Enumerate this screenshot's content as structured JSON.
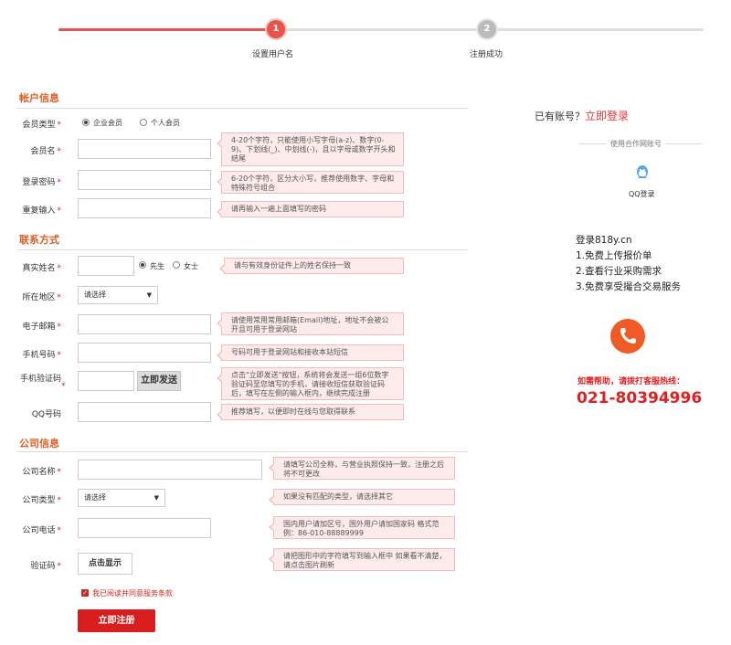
{
  "progress": {
    "fraction": 0.34,
    "steps": [
      {
        "num": "1",
        "label": "设置用户名",
        "state": "active"
      },
      {
        "num": "2",
        "label": "注册成功",
        "state": "inactive"
      }
    ]
  },
  "account": {
    "title": "帐户信息",
    "member_type_label": "会员类型",
    "member_type_options": [
      "企业会员",
      "个人会员"
    ],
    "member_type_selected": "企业会员",
    "username_label": "会员名",
    "username_tip": "4-20个字符，只能使用小写字母(a-z)、数字(0-9)、下划线(_)、中划线(-)，且以字母或数字开头和结尾",
    "password_label": "登录密码",
    "password_tip": "6-20个字符，区分大小写，推荐使用数字、字母和特殊符号组合",
    "repeat_label": "重复输入",
    "repeat_tip": "请再输入一遍上面填写的密码"
  },
  "contact": {
    "title": "联系方式",
    "name_label": "真实姓名",
    "gender_options": [
      "先生",
      "女士"
    ],
    "gender_selected": "先生",
    "name_tip": "请与有效身份证件上的姓名保持一致",
    "region_label": "所在地区",
    "region_value": "请选择",
    "email_label": "电子邮箱",
    "email_tip": "请使用常用常用邮箱(Email)地址，地址不会被公开且可用于登录网站",
    "mobile_label": "手机号码",
    "mobile_tip": "号码可用于登录网站和接收本站短信",
    "code_label": "手机验证码",
    "send_button": "立即发送",
    "code_tip": "点击\"立即发送\"按钮，系统将会发送一组6位数字验证码至您填写的手机，请接收短信获取验证码后，填写在左侧的输入框内，继续完成注册",
    "qq_label": "QQ号码",
    "qq_tip": "推荐填写，以便即时在线与您取得联系"
  },
  "company": {
    "title": "公司信息",
    "name_label": "公司名称",
    "name_tip": "请填写公司全称，与营业执照保持一致，注册之后将不可更改",
    "type_label": "公司类型",
    "type_value": "请选择",
    "type_tip": "如果没有匹配的类型，请选择其它",
    "phone_label": "公司电话",
    "phone_tip": "国内用户请加区号，国外用户请加国家码 格式范例：86-010-88889999",
    "captcha_label": "验证码",
    "captcha_button": "点击显示",
    "captcha_tip": "请把图形中的字符填写到输入框中 如果看不清楚，请点击图片刷新"
  },
  "agreement": {
    "checked": true,
    "text": "我已阅读并同意服务条款"
  },
  "submit_label": "立即注册",
  "side": {
    "have_account": "已有账号？",
    "login_link": "立即登录",
    "coop_title": "使用合作网账号",
    "qq_login": "QQ登录",
    "site": "登录818y.cn",
    "benefits": [
      "1.免费上传报价单",
      "2.查看行业采购需求",
      "3.免费享受撮合交易服务"
    ],
    "help_text": "如需帮助，请拨打客服热线：",
    "hotline": "021-80394996"
  },
  "colors": {
    "accent": "#e8534d",
    "section_title": "#e25d24",
    "primary_button": "#d81e1e",
    "phone_circle": "#f05a24",
    "qq_icon": "#5aa8e8"
  }
}
